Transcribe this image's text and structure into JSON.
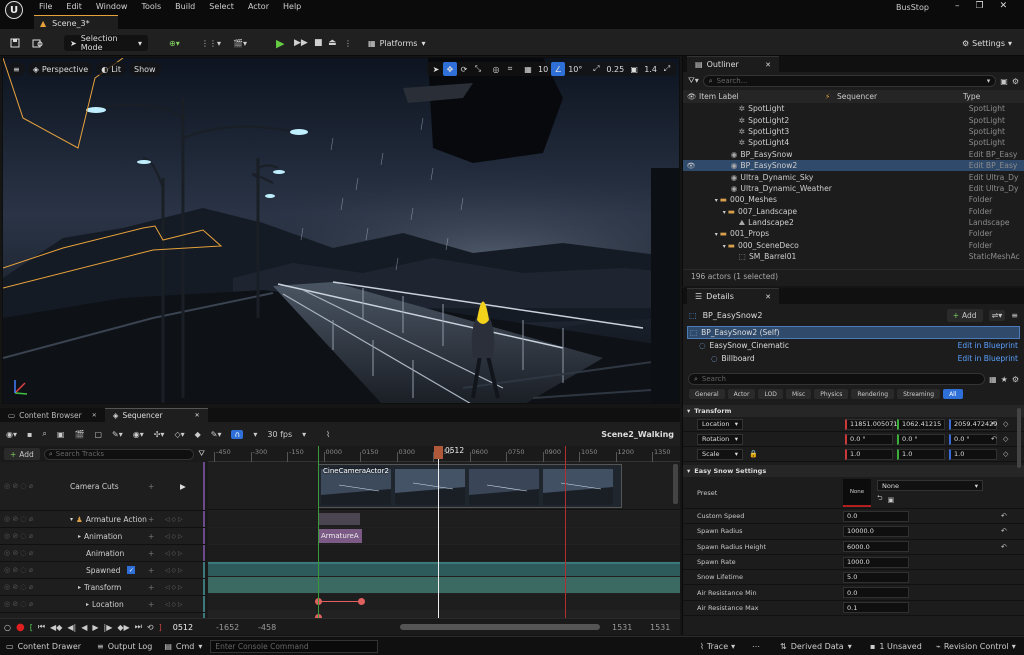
{
  "app": {
    "project": "BusStop",
    "scene_tab": "Scene_3*"
  },
  "menu": [
    "File",
    "Edit",
    "Window",
    "Tools",
    "Build",
    "Select",
    "Actor",
    "Help"
  ],
  "toolbar": {
    "mode": "Selection Mode",
    "platforms": "Platforms",
    "settings": "Settings"
  },
  "viewport": {
    "perspective": "Perspective",
    "lit": "Lit",
    "show": "Show",
    "grid_snap": "10",
    "angle_snap": "10°",
    "scale_snap": "0.25",
    "camera_speed": "1.4"
  },
  "outliner": {
    "title": "Outliner",
    "search_placeholder": "Search...",
    "col_label": "Item Label",
    "col_sequencer": "Sequencer",
    "col_type": "Type",
    "rows": [
      {
        "label": "SpotLight",
        "type": "SpotLight",
        "indent": 5,
        "icon": "spotlight"
      },
      {
        "label": "SpotLight2",
        "type": "SpotLight",
        "indent": 5,
        "icon": "spotlight"
      },
      {
        "label": "SpotLight3",
        "type": "SpotLight",
        "indent": 5,
        "icon": "spotlight"
      },
      {
        "label": "SpotLight4",
        "type": "SpotLight",
        "indent": 5,
        "icon": "spotlight"
      },
      {
        "label": "BP_EasySnow",
        "type": "Edit BP_Easy",
        "indent": 4,
        "icon": "actor",
        "link": true
      },
      {
        "label": "BP_EasySnow2",
        "type": "Edit BP_Easy",
        "indent": 4,
        "icon": "actor",
        "link": true,
        "selected": true
      },
      {
        "label": "Ultra_Dynamic_Sky",
        "type": "Edit Ultra_Dy",
        "indent": 4,
        "icon": "actor",
        "link": true
      },
      {
        "label": "Ultra_Dynamic_Weather",
        "type": "Edit Ultra_Dy",
        "indent": 4,
        "icon": "actor",
        "link": true
      },
      {
        "label": "000_Meshes",
        "type": "Folder",
        "indent": 2,
        "icon": "folder"
      },
      {
        "label": "007_Landscape",
        "type": "Folder",
        "indent": 3,
        "icon": "folder"
      },
      {
        "label": "Landscape2",
        "type": "Landscape",
        "indent": 5,
        "icon": "landscape"
      },
      {
        "label": "001_Props",
        "type": "Folder",
        "indent": 2,
        "icon": "folder"
      },
      {
        "label": "000_SceneDeco",
        "type": "Folder",
        "indent": 3,
        "icon": "folder"
      },
      {
        "label": "SM_Barrel01",
        "type": "StaticMeshAc",
        "indent": 5,
        "icon": "mesh"
      }
    ],
    "count": "196 actors (1 selected)"
  },
  "details": {
    "title": "Details",
    "actor": "BP_EasySnow2",
    "add": "Add",
    "components": [
      {
        "label": "BP_EasySnow2 (Self)",
        "edit": ""
      },
      {
        "label": "EasySnow_Cinematic",
        "edit": "Edit in Blueprint"
      },
      {
        "label": "Billboard",
        "edit": "Edit in Blueprint"
      }
    ],
    "search_placeholder": "Search",
    "filter_tabs": [
      "General",
      "Actor",
      "LOD",
      "Misc",
      "Physics",
      "Rendering",
      "Streaming",
      "All"
    ],
    "transform_header": "Transform",
    "location_label": "Location",
    "location": [
      "11851.005071",
      "1062.41215",
      "2059.472429"
    ],
    "rotation_label": "Rotation",
    "rotation": [
      "0.0 °",
      "0.0 °",
      "0.0 °"
    ],
    "scale_label": "Scale",
    "scale": [
      "1.0",
      "1.0",
      "1.0"
    ],
    "snow_header": "Easy Snow Settings",
    "preset_label": "Preset",
    "preset_thumb": "None",
    "preset_value": "None",
    "props": [
      {
        "label": "Custom Speed",
        "value": "0.0",
        "reset": true
      },
      {
        "label": "Spawn Radius",
        "value": "10000.0",
        "reset": true
      },
      {
        "label": "Spawn Radius Height",
        "value": "6000.0",
        "reset": true
      },
      {
        "label": "Spawn Rate",
        "value": "1000.0",
        "reset": false
      },
      {
        "label": "Snow Lifetime",
        "value": "5.0",
        "reset": false
      },
      {
        "label": "Air Resistance Min",
        "value": "0.0",
        "reset": false
      },
      {
        "label": "Air Resistance Max",
        "value": "0.1",
        "reset": false
      }
    ]
  },
  "sequencer": {
    "tab_content": "Content Browser",
    "tab_sequencer": "Sequencer",
    "fps": "30 fps",
    "sequence_name": "Scene2_Walking",
    "add": "Add",
    "search_placeholder": "Search Tracks",
    "current_frame": "0512",
    "ticks": [
      "-450",
      "-300",
      "-150",
      "0000",
      "0150",
      "0300",
      "0450",
      "0600",
      "0750",
      "0900",
      "1050",
      "1200",
      "1350"
    ],
    "tracks": [
      {
        "label": "Camera Cuts",
        "indent": 0,
        "tall": true
      },
      {
        "label": "Armature Action (X",
        "indent": 0
      },
      {
        "label": "Animation",
        "indent": 1
      },
      {
        "label": "Animation",
        "indent": 2
      },
      {
        "label": "Spawned",
        "indent": 2,
        "check": true
      },
      {
        "label": "Transform",
        "indent": 1
      },
      {
        "label": "Location",
        "indent": 2
      },
      {
        "label": "Rotation",
        "indent": 2
      }
    ],
    "camera_clip_label": "CineCameraActor2",
    "anim_clip_label": "ArmatureA",
    "transport_frame": "0512",
    "range_start": "-1652",
    "range_start2": "-458",
    "range_end": "1531",
    "range_end2": "1531"
  },
  "statusbar": {
    "content_drawer": "Content Drawer",
    "output_log": "Output Log",
    "cmd": "Cmd",
    "console_placeholder": "Enter Console Command",
    "trace": "Trace",
    "derived_data": "Derived Data",
    "unsaved": "1 Unsaved",
    "revision_control": "Revision Control"
  }
}
